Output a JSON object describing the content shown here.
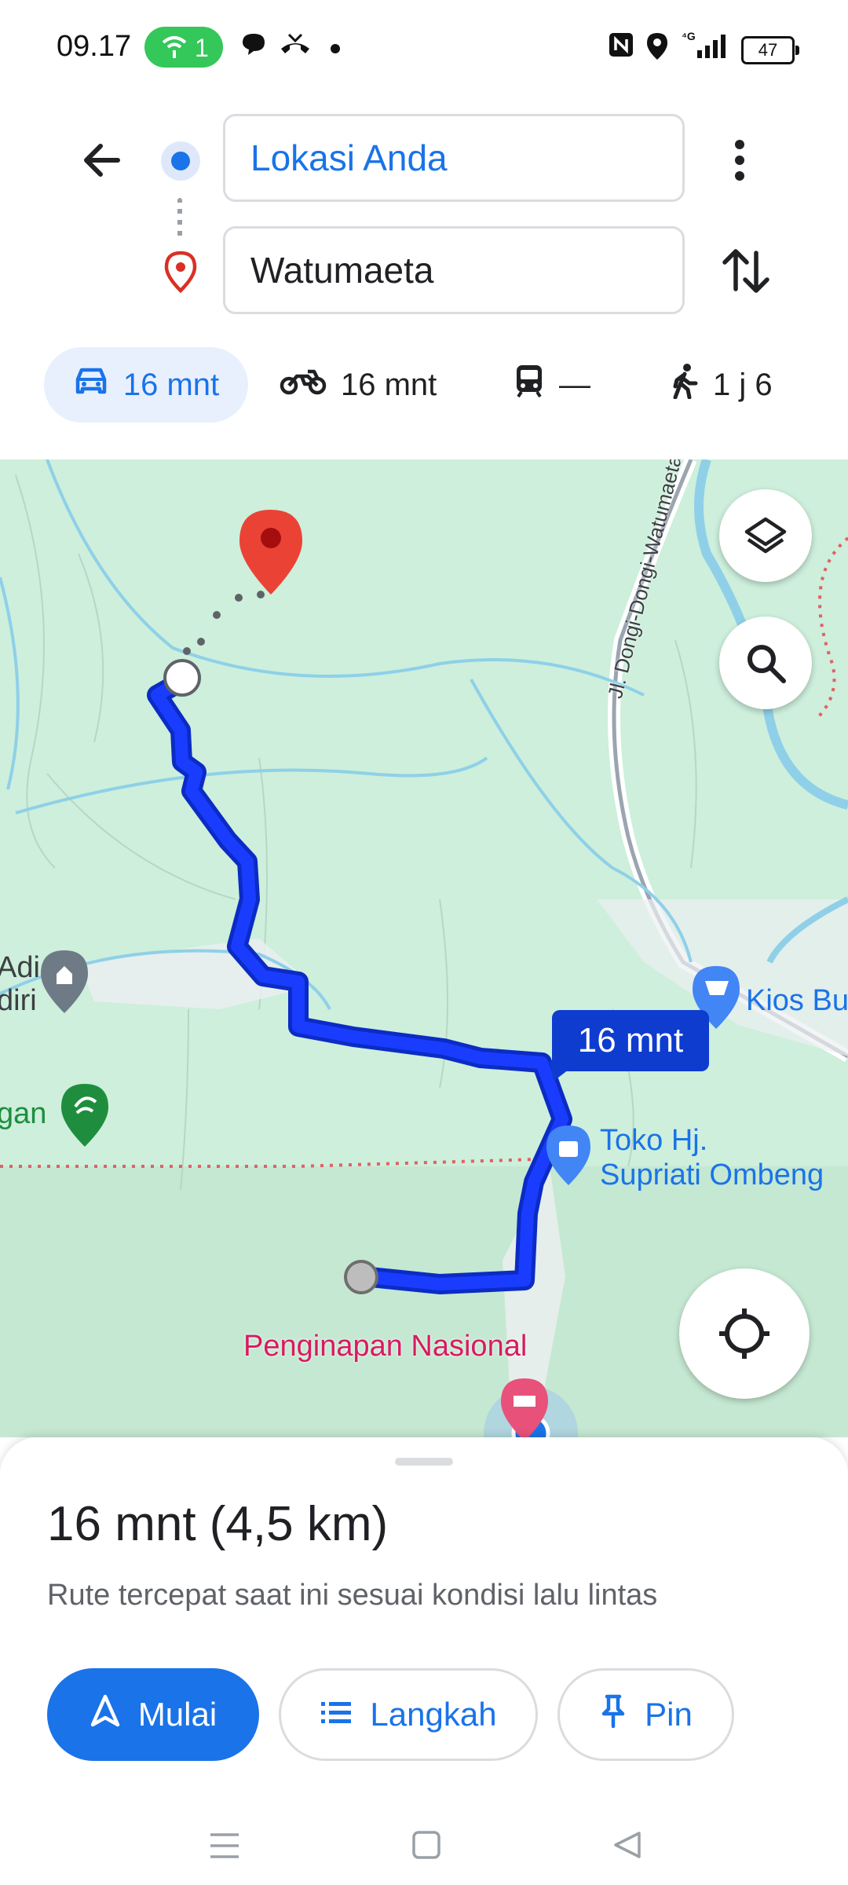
{
  "status_bar": {
    "time": "09.17",
    "hotspot_count": "1",
    "battery_level": "47",
    "network": "4G"
  },
  "directions": {
    "origin_value": "Lokasi Anda",
    "destination_value": "Watumaeta"
  },
  "modes": [
    {
      "name": "car",
      "label": "16 mnt",
      "active": true
    },
    {
      "name": "motorcycle",
      "label": "16 mnt"
    },
    {
      "name": "transit",
      "label": "—"
    },
    {
      "name": "walk",
      "label": "1 j 6"
    }
  ],
  "map": {
    "road_label": "Jl. Dongi-Dongi-Watumaeta",
    "route_eta": "16 mnt",
    "places": {
      "adi_line1": "Adi",
      "adi_line2": "diri",
      "gan": "gan",
      "kios": "Kios Bu",
      "toko_line1": "Toko Hj.",
      "toko_line2": "Supriati Ombeng",
      "penginapan": "Penginapan Nasional"
    },
    "route_color": "#1a3cff",
    "destination_pin_color": "#ea4335"
  },
  "summary": {
    "duration": "16 mnt (4,5 km)",
    "description": "Rute tercepat saat ini sesuai kondisi lalu lintas"
  },
  "actions": {
    "start": "Mulai",
    "steps": "Langkah",
    "pin": "Pin"
  },
  "colors": {
    "accent": "#1a73e8",
    "map_background": "#cdefdc"
  }
}
